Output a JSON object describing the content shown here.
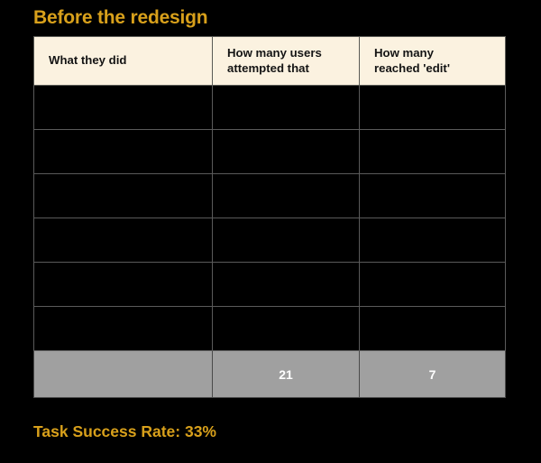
{
  "slide": {
    "title": "Before the redesign",
    "caption": "Task Success Rate: 33%",
    "background_color": "#000000",
    "accent_color": "#D8A01B"
  },
  "table": {
    "header_background": "#FBF2E0",
    "header_text_color": "#141414",
    "border_color": "#5a5a5a",
    "total_row_background": "#A0A0A0",
    "columns": [
      {
        "label_line1": "What they did",
        "label_line2": ""
      },
      {
        "label_line1": "How many users",
        "label_line2": "attempted that"
      },
      {
        "label_line1": "How many",
        "label_line2": "reached 'edit'"
      }
    ],
    "rows": [
      {
        "what": "",
        "attempted": "",
        "reached": ""
      },
      {
        "what": "",
        "attempted": "",
        "reached": ""
      },
      {
        "what": "",
        "attempted": "",
        "reached": ""
      },
      {
        "what": "",
        "attempted": "",
        "reached": ""
      },
      {
        "what": "",
        "attempted": "",
        "reached": ""
      },
      {
        "what": "",
        "attempted": "",
        "reached": ""
      }
    ],
    "total_row": {
      "what": "",
      "attempted": "21",
      "reached": "7"
    }
  },
  "chart_data": {
    "type": "table",
    "title": "Before the redesign",
    "columns": [
      "What they did",
      "How many users attempted that",
      "How many reached 'edit'"
    ],
    "rows": [
      [
        "",
        "",
        ""
      ],
      [
        "",
        "",
        ""
      ],
      [
        "",
        "",
        ""
      ],
      [
        "",
        "",
        ""
      ],
      [
        "",
        "",
        ""
      ],
      [
        "",
        "",
        ""
      ]
    ],
    "totals": [
      "",
      21,
      7
    ],
    "annotations": [
      "Task Success Rate: 33%"
    ]
  }
}
